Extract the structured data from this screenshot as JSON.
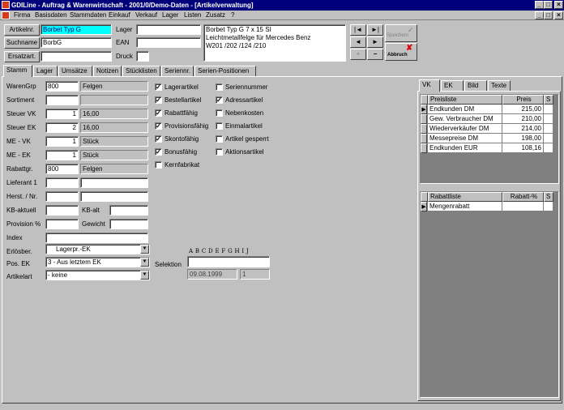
{
  "window": {
    "title": "GDILine - Auftrag & Warenwirtschaft - 2001/0/Demo-Daten - [Artikelverwaltung]",
    "controls": [
      "_",
      "□",
      "×"
    ],
    "mdi_controls": [
      "_",
      "□",
      "×"
    ]
  },
  "menu": [
    "Firma",
    "Basisdaten",
    "Stammdaten",
    "Einkauf",
    "Verkauf",
    "Lager",
    "Listen",
    "Zusatz",
    "?"
  ],
  "header": {
    "artikelnr_label": "Artikelnr.",
    "artikelnr_value": "Borbet Typ G",
    "suchname_label": "Suchname",
    "suchname_value": "BorbG",
    "ersatzart_label": "Ersatzart.",
    "ersatzart_value": "",
    "lager_label": "Lager",
    "lager_value": "",
    "ean_label": "EAN",
    "ean_value": "",
    "druck_label": "Druck",
    "druck_value": "",
    "description_lines": [
      "Borbet Typ G 7 x 15 SI",
      "Leichtmetallfelge für Mercedes Benz",
      "W201 /202 /124 /210"
    ]
  },
  "navigation": {
    "first": "|◄",
    "last": "►|",
    "prev": "◄",
    "next": "►",
    "add": "+",
    "remove": "−",
    "speichern_label": "Speichern",
    "abbruch_label": "Abbruch"
  },
  "tabs": [
    "Stamm",
    "Lager",
    "Umsätze",
    "Notizen",
    "Stücklisten",
    "Seriennr.",
    "Serien-Positionen"
  ],
  "stamm": {
    "warengrp": {
      "label": "WarenGrp",
      "code": "800",
      "text": "Felgen"
    },
    "sortiment": {
      "label": "Sortiment",
      "code": "",
      "text": ""
    },
    "steuer_vk": {
      "label": "Steuer VK",
      "code": "1",
      "text": "16,00"
    },
    "steuer_ek": {
      "label": "Steuer EK",
      "code": "2",
      "text": "16,00"
    },
    "me_vk": {
      "label": "ME - VK",
      "code": "1",
      "text": "Stück"
    },
    "me_ek": {
      "label": "ME - EK",
      "code": "1",
      "text": "Stück"
    },
    "rabattgr": {
      "label": "Rabattgr.",
      "code": "800",
      "text": "Felgen"
    },
    "lieferant": {
      "label": "Lieferant 1",
      "code": "",
      "text": ""
    },
    "herst": {
      "label": "Herst. / Nr.",
      "code": "",
      "text": ""
    },
    "kb_aktuell": {
      "label": "KB-aktuell",
      "value": "",
      "alt_label": "KB-alt",
      "alt_value": ""
    },
    "provision": {
      "label": "Provision %",
      "value": "",
      "gewicht_label": "Gewicht",
      "gewicht_value": ""
    },
    "index": {
      "label": "Index",
      "value": ""
    },
    "erloesber": {
      "label": "Erlösber.",
      "value": "Lagerpr.-EK"
    },
    "pos_ek": {
      "label": "Pos. EK",
      "value": "3 - Aus letztem EK"
    },
    "artikelart": {
      "label": "Artikelart",
      "value": "- keine"
    },
    "checkboxes_left": [
      {
        "label": "Lagerartikel",
        "checked": true
      },
      {
        "label": "Bestellartikel",
        "checked": true
      },
      {
        "label": "Rabattfähig",
        "checked": true
      },
      {
        "label": "Provisionsfähig",
        "checked": true
      },
      {
        "label": "Skontofähig",
        "checked": true
      },
      {
        "label": "Bonusfähig",
        "checked": true
      },
      {
        "label": "Kernfabrikat",
        "checked": false
      }
    ],
    "checkboxes_right": [
      {
        "label": "Seriennummer",
        "checked": false
      },
      {
        "label": "Adressartikel",
        "checked": true
      },
      {
        "label": "Nebenkosten",
        "checked": false
      },
      {
        "label": "Einmalartikel",
        "checked": false
      },
      {
        "label": "Artikel gesperrt",
        "checked": false
      },
      {
        "label": "Aktionsartikel",
        "checked": false
      }
    ],
    "selektion": {
      "letters": "A B C D E F G H I J",
      "label": "Selektion",
      "value": "",
      "date": "09.08.1999",
      "count": "1"
    }
  },
  "right_tabs": [
    "VK",
    "EK",
    "Bild",
    "Texte"
  ],
  "preisliste": {
    "headers": [
      "Preisliste",
      "Preis",
      "S"
    ],
    "rows": [
      {
        "name": "Endkunden DM",
        "price": "215,00",
        "s": ""
      },
      {
        "name": "Gew. Verbraucher DM",
        "price": "210,00",
        "s": ""
      },
      {
        "name": "Wiederverkäufer DM",
        "price": "214,00",
        "s": ""
      },
      {
        "name": "Messepreise DM",
        "price": "198,00",
        "s": ""
      },
      {
        "name": "Endkunden EUR",
        "price": "108,16",
        "s": ""
      }
    ]
  },
  "rabattliste": {
    "headers": [
      "Rabattliste",
      "Rabatt-%",
      "S"
    ],
    "rows": [
      {
        "name": "Mengenrabatt",
        "rabatt": "",
        "s": ""
      }
    ]
  }
}
